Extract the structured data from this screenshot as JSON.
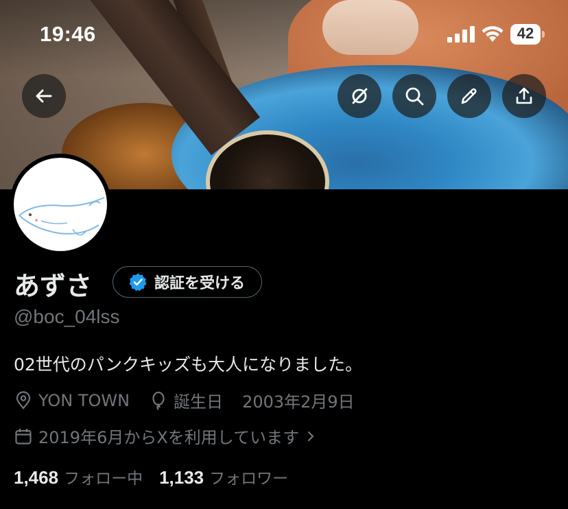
{
  "status_bar": {
    "time": "19:46",
    "battery": "42"
  },
  "nav": {
    "back_icon": "arrow-left-icon",
    "actions": [
      "grok-icon",
      "search-icon",
      "edit-icon",
      "share-icon"
    ]
  },
  "profile": {
    "name": "あずさ",
    "verify_label": "認証を受ける",
    "handle": "@boc_04lss",
    "bio": "02世代のパンクキッズも大人になりました。",
    "location": "YON TOWN",
    "birthday_label": "誕生日",
    "birthday": "2003年2月9日",
    "joined": "2019年6月からXを利用しています",
    "following_count": "1,468",
    "following_label": "フォロー中",
    "followers_count": "1,133",
    "followers_label": "フォロワー"
  },
  "colors": {
    "background": "#000000",
    "text_primary": "#e7e9ea",
    "text_secondary": "#71767b",
    "verified_blue": "#1d9bf0"
  }
}
